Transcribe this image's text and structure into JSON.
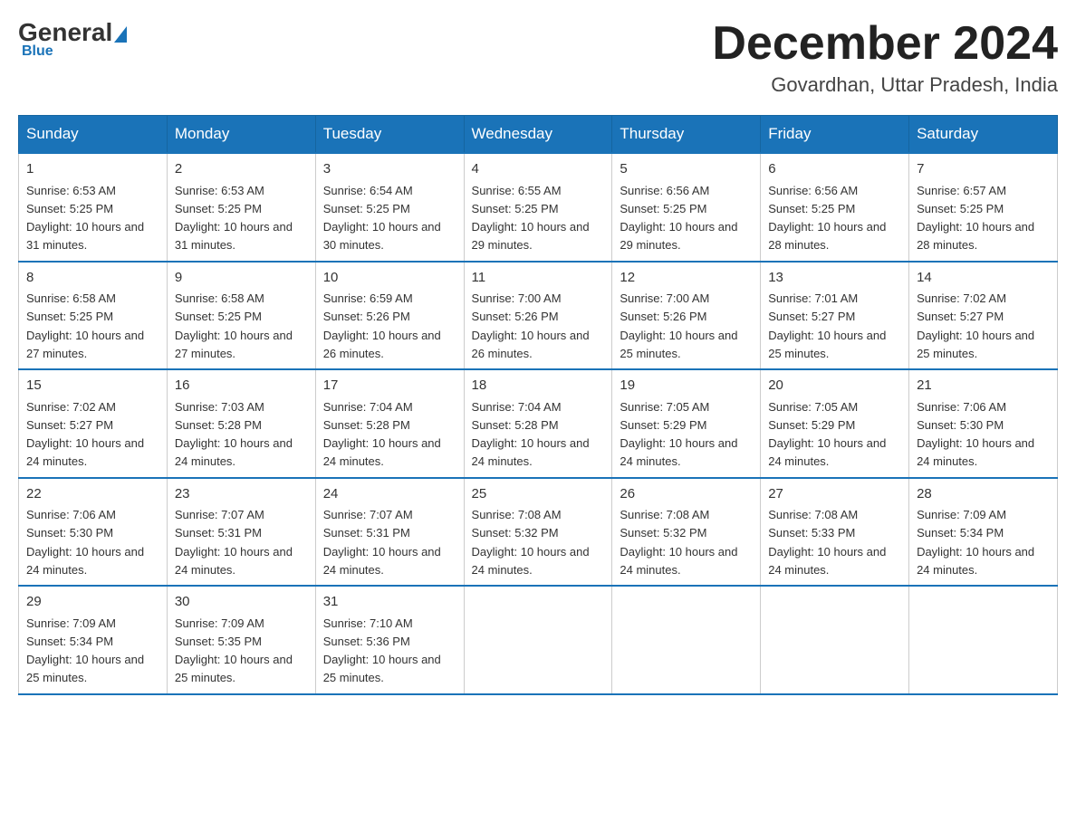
{
  "header": {
    "logo": {
      "general": "General",
      "blue": "Blue"
    },
    "title": "December 2024",
    "location": "Govardhan, Uttar Pradesh, India"
  },
  "weekdays": [
    "Sunday",
    "Monday",
    "Tuesday",
    "Wednesday",
    "Thursday",
    "Friday",
    "Saturday"
  ],
  "weeks": [
    [
      {
        "day": "1",
        "sunrise": "6:53 AM",
        "sunset": "5:25 PM",
        "daylight": "10 hours and 31 minutes."
      },
      {
        "day": "2",
        "sunrise": "6:53 AM",
        "sunset": "5:25 PM",
        "daylight": "10 hours and 31 minutes."
      },
      {
        "day": "3",
        "sunrise": "6:54 AM",
        "sunset": "5:25 PM",
        "daylight": "10 hours and 30 minutes."
      },
      {
        "day": "4",
        "sunrise": "6:55 AM",
        "sunset": "5:25 PM",
        "daylight": "10 hours and 29 minutes."
      },
      {
        "day": "5",
        "sunrise": "6:56 AM",
        "sunset": "5:25 PM",
        "daylight": "10 hours and 29 minutes."
      },
      {
        "day": "6",
        "sunrise": "6:56 AM",
        "sunset": "5:25 PM",
        "daylight": "10 hours and 28 minutes."
      },
      {
        "day": "7",
        "sunrise": "6:57 AM",
        "sunset": "5:25 PM",
        "daylight": "10 hours and 28 minutes."
      }
    ],
    [
      {
        "day": "8",
        "sunrise": "6:58 AM",
        "sunset": "5:25 PM",
        "daylight": "10 hours and 27 minutes."
      },
      {
        "day": "9",
        "sunrise": "6:58 AM",
        "sunset": "5:25 PM",
        "daylight": "10 hours and 27 minutes."
      },
      {
        "day": "10",
        "sunrise": "6:59 AM",
        "sunset": "5:26 PM",
        "daylight": "10 hours and 26 minutes."
      },
      {
        "day": "11",
        "sunrise": "7:00 AM",
        "sunset": "5:26 PM",
        "daylight": "10 hours and 26 minutes."
      },
      {
        "day": "12",
        "sunrise": "7:00 AM",
        "sunset": "5:26 PM",
        "daylight": "10 hours and 25 minutes."
      },
      {
        "day": "13",
        "sunrise": "7:01 AM",
        "sunset": "5:27 PM",
        "daylight": "10 hours and 25 minutes."
      },
      {
        "day": "14",
        "sunrise": "7:02 AM",
        "sunset": "5:27 PM",
        "daylight": "10 hours and 25 minutes."
      }
    ],
    [
      {
        "day": "15",
        "sunrise": "7:02 AM",
        "sunset": "5:27 PM",
        "daylight": "10 hours and 24 minutes."
      },
      {
        "day": "16",
        "sunrise": "7:03 AM",
        "sunset": "5:28 PM",
        "daylight": "10 hours and 24 minutes."
      },
      {
        "day": "17",
        "sunrise": "7:04 AM",
        "sunset": "5:28 PM",
        "daylight": "10 hours and 24 minutes."
      },
      {
        "day": "18",
        "sunrise": "7:04 AM",
        "sunset": "5:28 PM",
        "daylight": "10 hours and 24 minutes."
      },
      {
        "day": "19",
        "sunrise": "7:05 AM",
        "sunset": "5:29 PM",
        "daylight": "10 hours and 24 minutes."
      },
      {
        "day": "20",
        "sunrise": "7:05 AM",
        "sunset": "5:29 PM",
        "daylight": "10 hours and 24 minutes."
      },
      {
        "day": "21",
        "sunrise": "7:06 AM",
        "sunset": "5:30 PM",
        "daylight": "10 hours and 24 minutes."
      }
    ],
    [
      {
        "day": "22",
        "sunrise": "7:06 AM",
        "sunset": "5:30 PM",
        "daylight": "10 hours and 24 minutes."
      },
      {
        "day": "23",
        "sunrise": "7:07 AM",
        "sunset": "5:31 PM",
        "daylight": "10 hours and 24 minutes."
      },
      {
        "day": "24",
        "sunrise": "7:07 AM",
        "sunset": "5:31 PM",
        "daylight": "10 hours and 24 minutes."
      },
      {
        "day": "25",
        "sunrise": "7:08 AM",
        "sunset": "5:32 PM",
        "daylight": "10 hours and 24 minutes."
      },
      {
        "day": "26",
        "sunrise": "7:08 AM",
        "sunset": "5:32 PM",
        "daylight": "10 hours and 24 minutes."
      },
      {
        "day": "27",
        "sunrise": "7:08 AM",
        "sunset": "5:33 PM",
        "daylight": "10 hours and 24 minutes."
      },
      {
        "day": "28",
        "sunrise": "7:09 AM",
        "sunset": "5:34 PM",
        "daylight": "10 hours and 24 minutes."
      }
    ],
    [
      {
        "day": "29",
        "sunrise": "7:09 AM",
        "sunset": "5:34 PM",
        "daylight": "10 hours and 25 minutes."
      },
      {
        "day": "30",
        "sunrise": "7:09 AM",
        "sunset": "5:35 PM",
        "daylight": "10 hours and 25 minutes."
      },
      {
        "day": "31",
        "sunrise": "7:10 AM",
        "sunset": "5:36 PM",
        "daylight": "10 hours and 25 minutes."
      },
      null,
      null,
      null,
      null
    ]
  ],
  "labels": {
    "sunrise": "Sunrise:",
    "sunset": "Sunset:",
    "daylight": "Daylight:"
  }
}
